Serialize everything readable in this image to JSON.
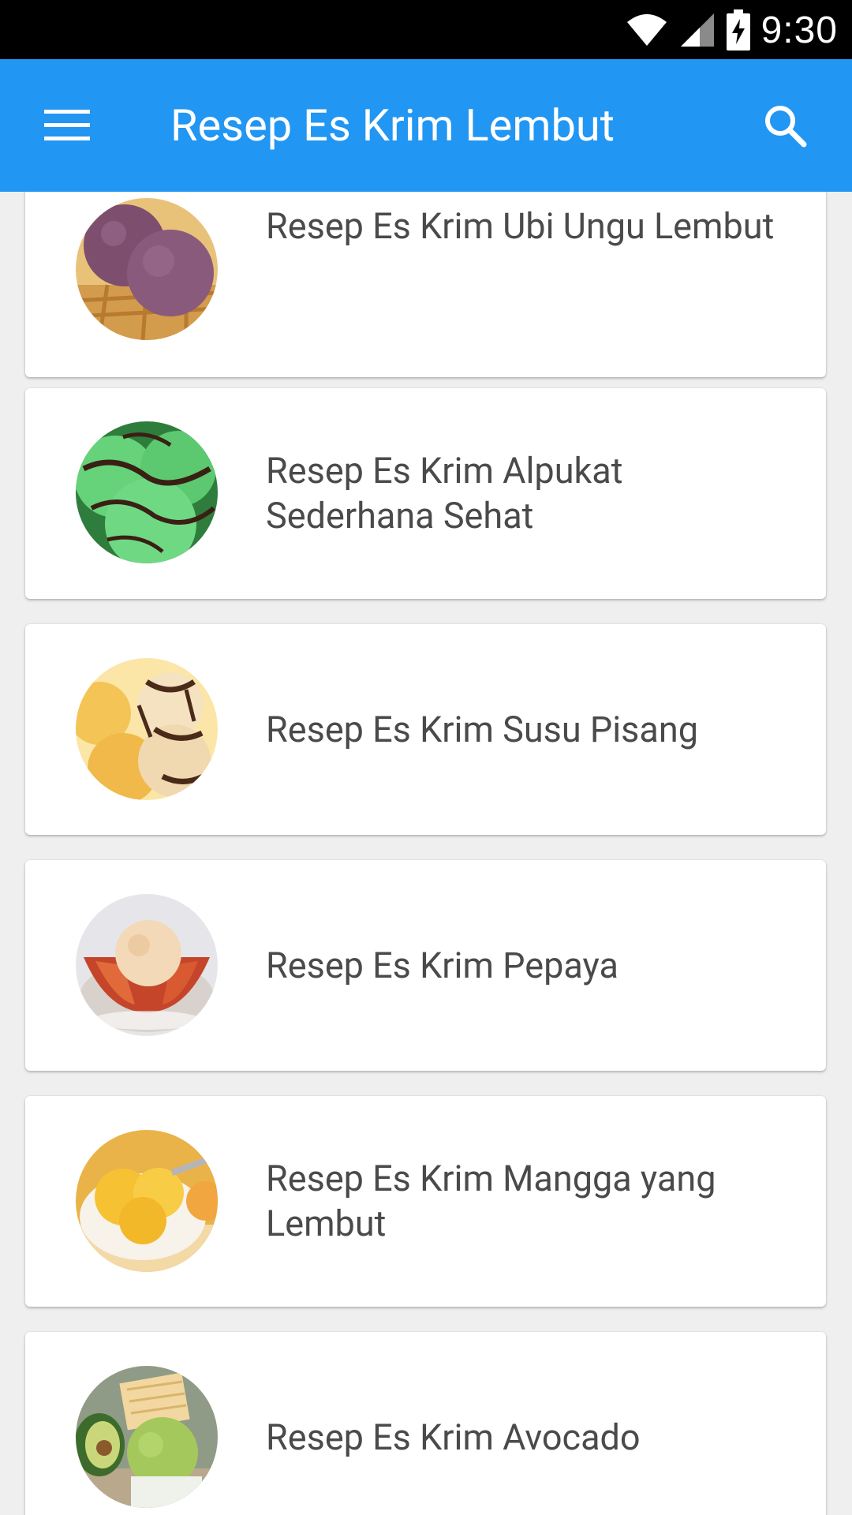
{
  "status_bar": {
    "time": "9:30",
    "icons": [
      "wifi-icon",
      "cell-signal-icon",
      "battery-charging-icon"
    ]
  },
  "app_bar": {
    "title": "Resep Es Krim Lembut",
    "menu_icon": "hamburger-menu-icon",
    "search_icon": "search-icon",
    "color": "#2196f3"
  },
  "recipes": [
    {
      "title": "Resep Es Krim Ubi Ungu Lembut",
      "image": "purple-ice-cream-thumbnail"
    },
    {
      "title": "Resep Es Krim Alpukat Sederhana Sehat",
      "image": "green-mint-ice-cream-thumbnail"
    },
    {
      "title": "Resep Es Krim Susu Pisang",
      "image": "banana-ice-cream-thumbnail"
    },
    {
      "title": "Resep Es Krim Pepaya",
      "image": "papaya-ice-cream-thumbnail"
    },
    {
      "title": "Resep Es Krim Mangga yang Lembut",
      "image": "mango-ice-cream-thumbnail"
    },
    {
      "title": "Resep Es Krim Avocado",
      "image": "avocado-ice-cream-thumbnail"
    }
  ]
}
